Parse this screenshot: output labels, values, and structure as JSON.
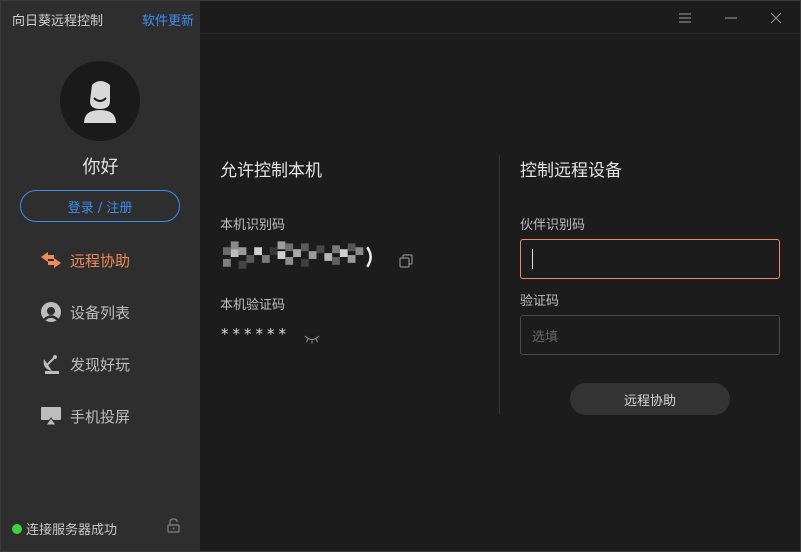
{
  "sidebar": {
    "app_title": "向日葵远程控制",
    "update_link": "软件更新",
    "greeting": "你好",
    "login_label": "登录 / 注册",
    "items": [
      {
        "label": "远程协助",
        "icon": "remote-assist-icon",
        "active": true
      },
      {
        "label": "设备列表",
        "icon": "device-list-icon",
        "active": false
      },
      {
        "label": "发现好玩",
        "icon": "discover-icon",
        "active": false
      },
      {
        "label": "手机投屏",
        "icon": "screen-cast-icon",
        "active": false
      }
    ],
    "status_text": "连接服务器成功"
  },
  "colors": {
    "accent_orange": "#f08a5d",
    "link_blue": "#3d8cf0",
    "status_green": "#3fd13f"
  },
  "allow_panel": {
    "title": "允许控制本机",
    "id_label": "本机识别码",
    "code_label": "本机验证码",
    "code_value": "******"
  },
  "control_panel": {
    "title": "控制远程设备",
    "partner_label": "伙伴识别码",
    "partner_value": "",
    "verify_label": "验证码",
    "verify_placeholder": "选填",
    "assist_button": "远程协助"
  }
}
